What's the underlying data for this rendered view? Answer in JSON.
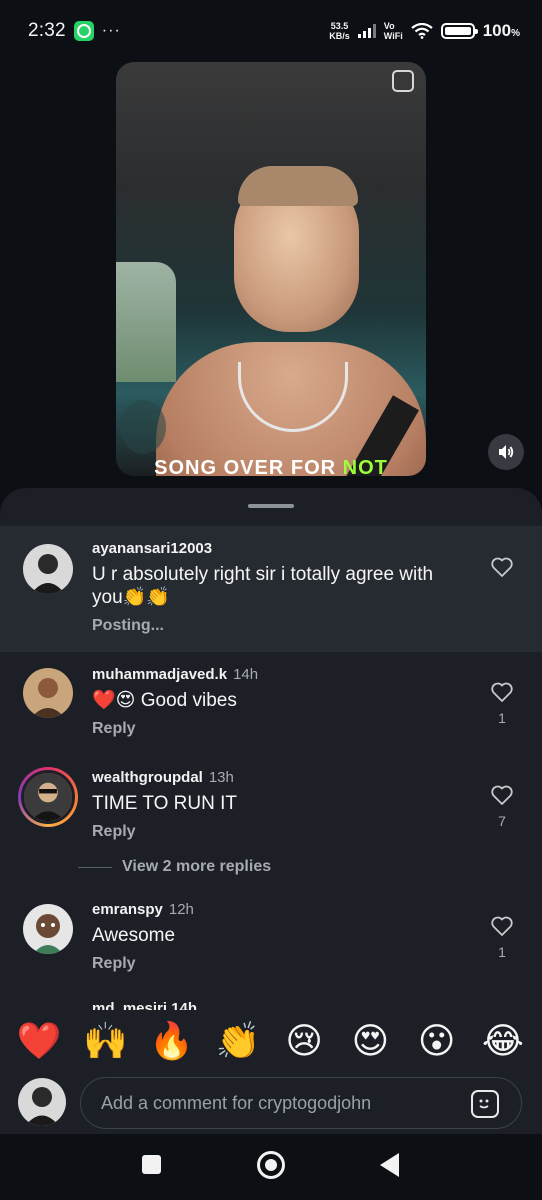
{
  "status_bar": {
    "time": "2:32",
    "more": "···",
    "net_speed_value": "53.5",
    "net_speed_unit": "KB/s",
    "vo": "Vo",
    "wifi_label": "WiFi",
    "battery_pct": "100",
    "battery_unit": "%"
  },
  "video": {
    "caption_white": "SONG OVER FOR ",
    "caption_green": "NOT"
  },
  "comments": [
    {
      "username": "ayanansari12003",
      "time": "",
      "text": "U r absolutely right sir i totally agree with you👏👏",
      "footer": "Posting...",
      "likes": ""
    },
    {
      "username": "muhammadjaved.k",
      "time": "14h",
      "text": "❤️😍 Good vibes",
      "footer": "Reply",
      "likes": "1"
    },
    {
      "username": "wealthgroupdal",
      "time": "13h",
      "text": "TIME TO RUN IT",
      "footer": "Reply",
      "likes": "7"
    },
    {
      "username": "emranspy",
      "time": "12h",
      "text": "Awesome",
      "footer": "Reply",
      "likes": "1"
    }
  ],
  "view_more_replies": "View 2 more replies",
  "partial_username": "md_mesiri 14h",
  "emoji_bar": [
    "❤️",
    "🙌",
    "🔥",
    "👏",
    "😢",
    "😍",
    "😮",
    "😂"
  ],
  "composer": {
    "placeholder": "Add a comment for cryptogodjohn"
  },
  "colors": {
    "background": "#0c0f14",
    "sheet": "#1c2026",
    "highlight": "#262b32",
    "muted_text": "#a7abb1",
    "caption_green": "#9dff3b",
    "story_ring": "#e1306c"
  }
}
